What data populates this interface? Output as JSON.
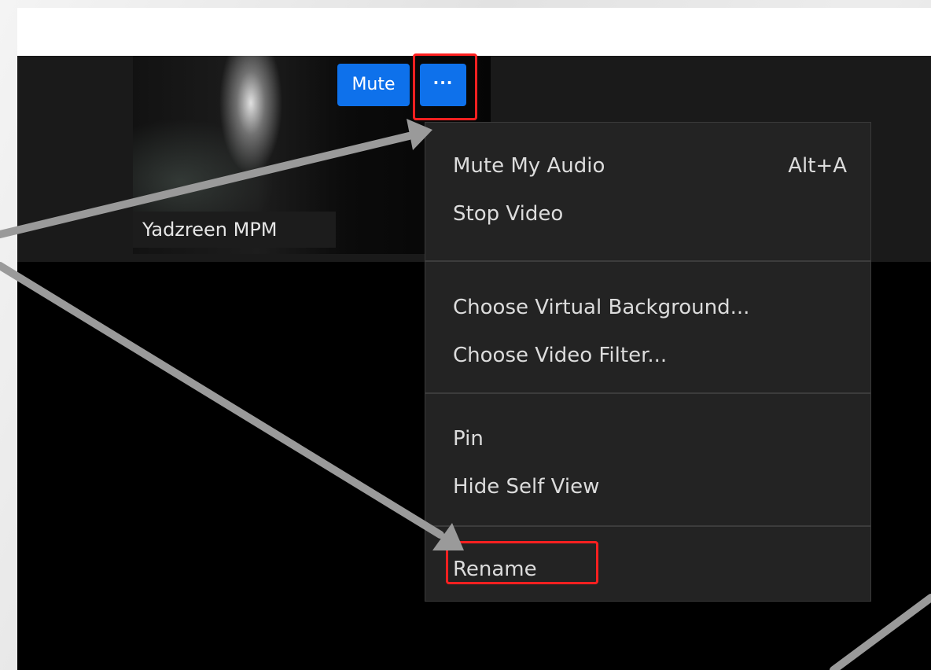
{
  "video_tile": {
    "participant_name": "Yadzreen MPM",
    "mute_label": "Mute",
    "more_label": "···"
  },
  "context_menu": {
    "items": [
      {
        "label": "Mute My Audio",
        "shortcut": "Alt+A"
      },
      {
        "label": "Stop Video"
      },
      {
        "label": "Choose Virtual Background..."
      },
      {
        "label": "Choose Video Filter..."
      },
      {
        "label": "Pin"
      },
      {
        "label": "Hide Self View"
      },
      {
        "label": "Rename"
      }
    ]
  },
  "colors": {
    "accent": "#0e71eb",
    "highlight_box": "#ff2020",
    "arrow": "#9a9a9a",
    "menu_bg": "#232323"
  }
}
